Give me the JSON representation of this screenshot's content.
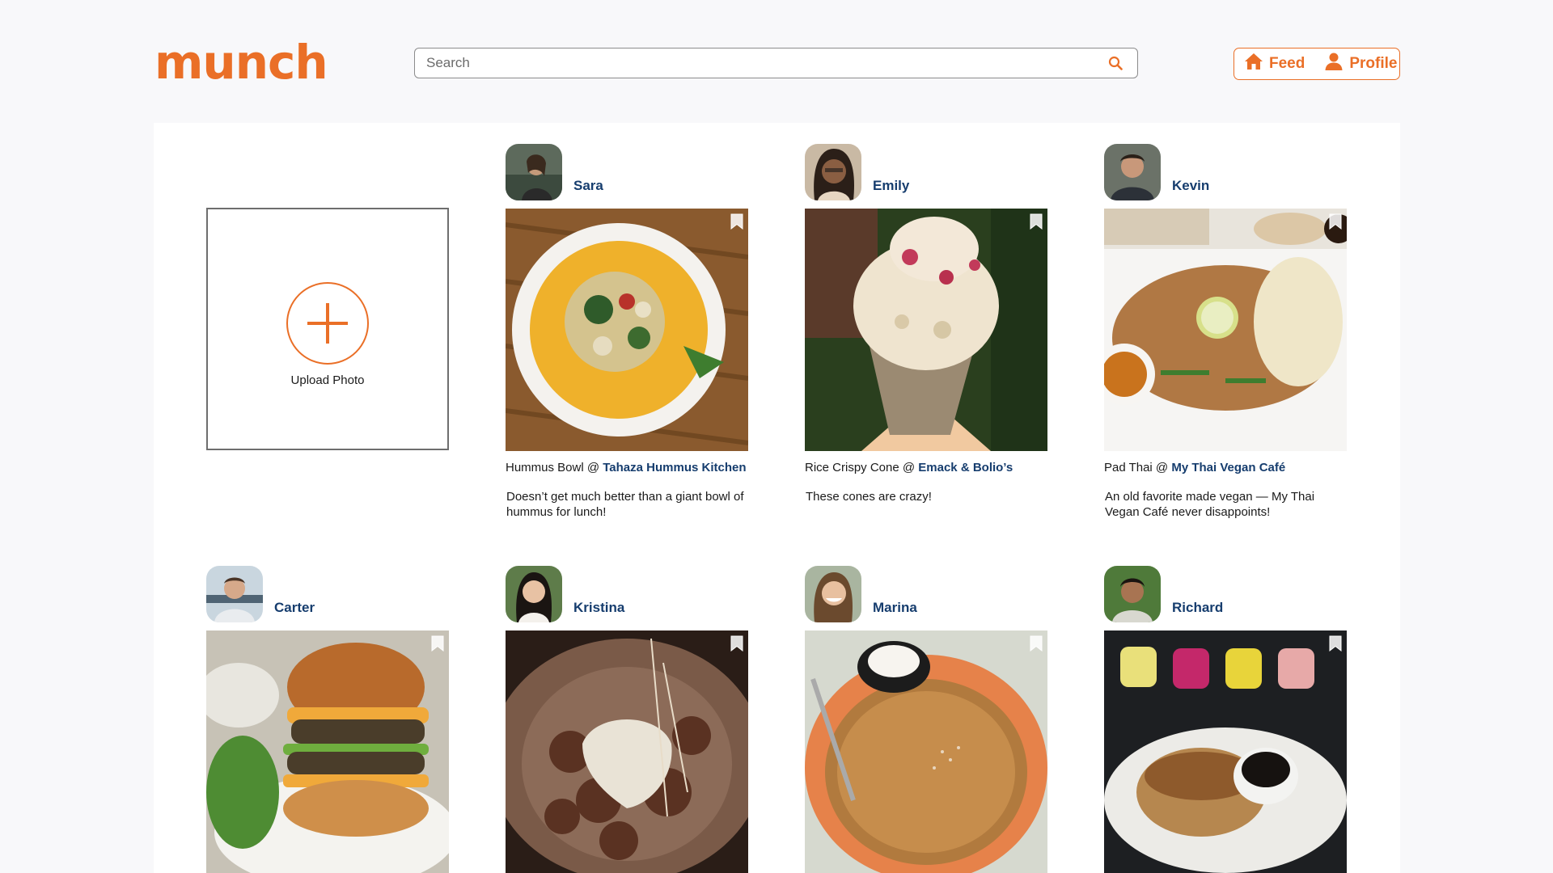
{
  "brand": {
    "name": "munch",
    "accent": "#ea6f27",
    "link_color": "#163d6e"
  },
  "search": {
    "placeholder": "Search",
    "value": "",
    "icon": "search-icon"
  },
  "nav": [
    {
      "label": "Feed",
      "icon": "home-icon"
    },
    {
      "label": "Profile",
      "icon": "user-icon"
    }
  ],
  "upload": {
    "label": "Upload Photo",
    "icon": "plus-circle-icon"
  },
  "posts": [
    {
      "user": "Sara",
      "dish": "Hummus Bowl @ ",
      "place": "Tahaza Hummus Kitchen",
      "description": "Doesn’t get much better than a giant bowl of hummus for lunch!"
    },
    {
      "user": "Emily",
      "dish": "Rice Crispy Cone @ ",
      "place": "Emack & Bolio’s",
      "description": "These cones are crazy!"
    },
    {
      "user": "Kevin",
      "dish": "Pad Thai @ ",
      "place": "My Thai Vegan Café",
      "description": "An old favorite made vegan — My Thai Vegan Café never disappoints!"
    },
    {
      "user": "Carter"
    },
    {
      "user": "Kristina"
    },
    {
      "user": "Marina"
    },
    {
      "user": "Richard"
    }
  ]
}
